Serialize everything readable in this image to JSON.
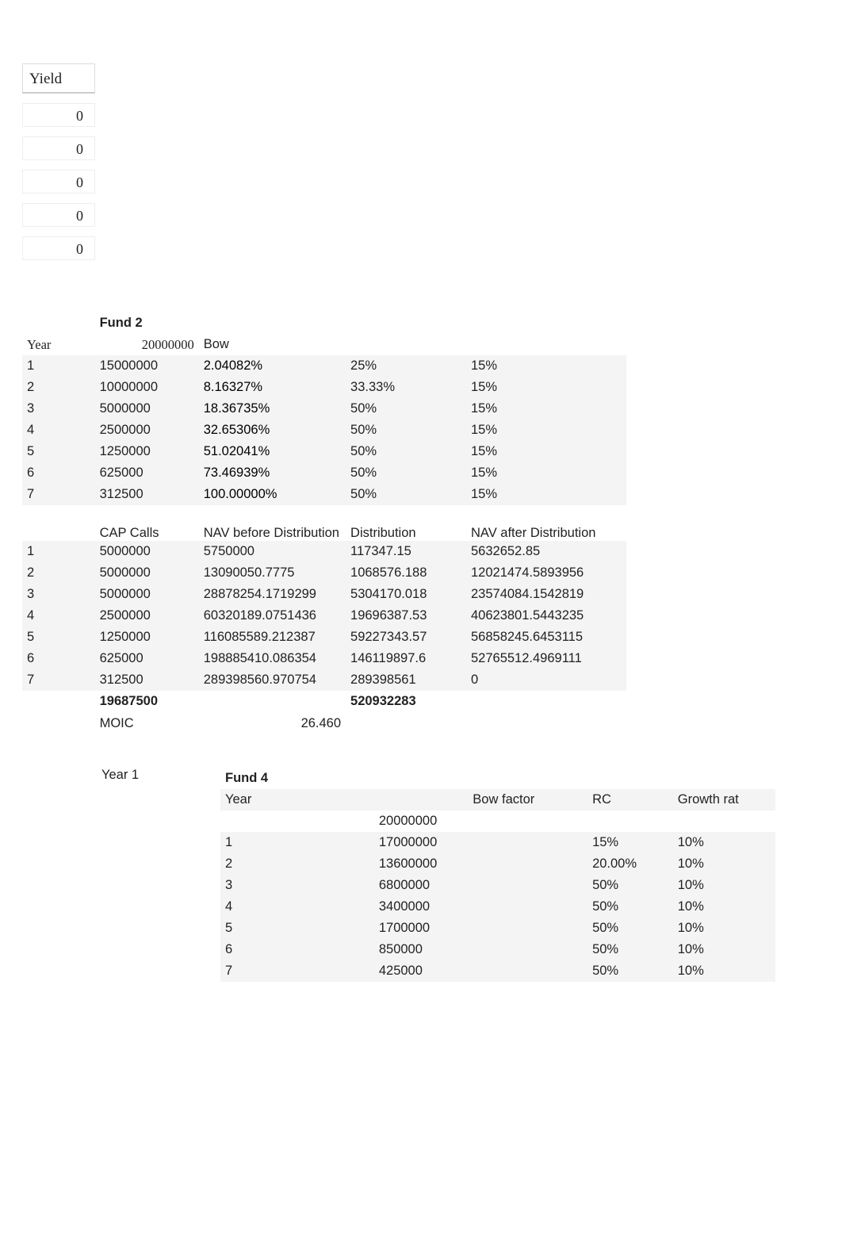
{
  "yield": {
    "header": "Yield",
    "values": [
      "0",
      "0",
      "0",
      "0",
      "0"
    ]
  },
  "fund2": {
    "title": "Fund 2",
    "year_label": "Year",
    "bow_label": "Bow",
    "top_value": "20000000",
    "rows": [
      {
        "year": "1",
        "val": "15000000",
        "bow": "2.04082%",
        "c1": "25%",
        "c2": "15%",
        "grad": "g0"
      },
      {
        "year": "2",
        "val": "10000000",
        "bow": "8.16327%",
        "c1": "33.33%",
        "c2": "15%",
        "grad": "g1"
      },
      {
        "year": "3",
        "val": "5000000",
        "bow": "18.36735%",
        "c1": "50%",
        "c2": "15%",
        "grad": "g2"
      },
      {
        "year": "4",
        "val": "2500000",
        "bow": "32.65306%",
        "c1": "50%",
        "c2": "15%",
        "grad": "g3"
      },
      {
        "year": "5",
        "val": "1250000",
        "bow": "51.02041%",
        "c1": "50%",
        "c2": "15%",
        "grad": "g4"
      },
      {
        "year": "6",
        "val": "625000",
        "bow": "73.46939%",
        "c1": "50%",
        "c2": "15%",
        "grad": "g5"
      },
      {
        "year": "7",
        "val": "312500",
        "bow": "100.00000%",
        "c1": "50%",
        "c2": "15%",
        "grad": "g6"
      }
    ],
    "sub_headers": {
      "cap": "CAP Calls",
      "nav_before": "NAV before Distribution",
      "dist": "Distribution",
      "nav_after": "NAV after Distribution"
    },
    "dist_rows": [
      {
        "n": "1",
        "cap": "5000000",
        "navb": "5750000",
        "dist": "117347.15",
        "nava": "5632652.85"
      },
      {
        "n": "2",
        "cap": "5000000",
        "navb": "13090050.7775",
        "dist": "1068576.188",
        "nava": "12021474.5893956"
      },
      {
        "n": "3",
        "cap": "5000000",
        "navb": "28878254.1719299",
        "dist": "5304170.018",
        "nava": "23574084.1542819"
      },
      {
        "n": "4",
        "cap": "2500000",
        "navb": "60320189.0751436",
        "dist": "19696387.53",
        "nava": "40623801.5443235"
      },
      {
        "n": "5",
        "cap": "1250000",
        "navb": "116085589.212387",
        "dist": "59227343.57",
        "nava": "56858245.6453115"
      },
      {
        "n": "6",
        "cap": "625000",
        "navb": "198885410.086354",
        "dist": "146119897.6",
        "nava": "52765512.4969111"
      },
      {
        "n": "7",
        "cap": "312500",
        "navb": "289398560.970754",
        "dist": "289398561",
        "nava": "0"
      }
    ],
    "totals": {
      "cap": "19687500",
      "dist": "520932283"
    },
    "moic": {
      "label": "MOIC",
      "value": "26.460"
    }
  },
  "fund4": {
    "side_label": "Year 1",
    "title": "Fund 4",
    "headers": {
      "year": "Year",
      "bow": "Bow factor",
      "rc": "RC",
      "growth": "Growth rat"
    },
    "top_value": "20000000",
    "rows": [
      {
        "n": "1",
        "val": "17000000",
        "rc": "15%",
        "gr": "10%"
      },
      {
        "n": "2",
        "val": "13600000",
        "rc": "20.00%",
        "gr": "10%"
      },
      {
        "n": "3",
        "val": "6800000",
        "rc": "50%",
        "gr": "10%"
      },
      {
        "n": "4",
        "val": "3400000",
        "rc": "50%",
        "gr": "10%"
      },
      {
        "n": "5",
        "val": "1700000",
        "rc": "50%",
        "gr": "10%"
      },
      {
        "n": "6",
        "val": "850000",
        "rc": "50%",
        "gr": "10%"
      },
      {
        "n": "7",
        "val": "425000",
        "rc": "50%",
        "gr": "10%"
      }
    ]
  }
}
